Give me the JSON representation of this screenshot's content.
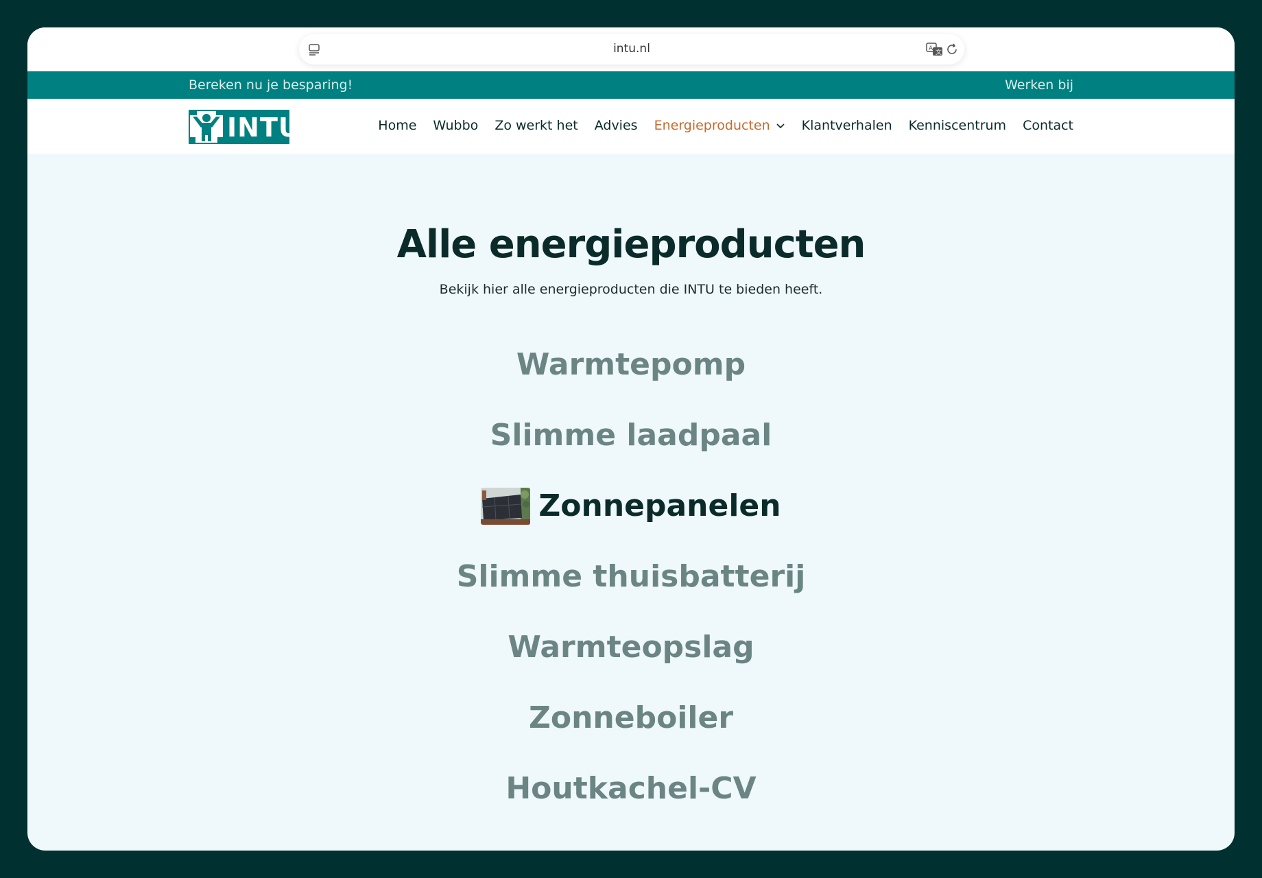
{
  "browser": {
    "url": "intu.nl"
  },
  "topbar": {
    "left_link": "Bereken nu je besparing!",
    "right_link": "Werken bij"
  },
  "logo": {
    "text": "INTU",
    "color": "#008080"
  },
  "nav": {
    "items": [
      {
        "label": "Home"
      },
      {
        "label": "Wubbo"
      },
      {
        "label": "Zo werkt het"
      },
      {
        "label": "Advies"
      },
      {
        "label": "Energieproducten",
        "active": true
      },
      {
        "label": "Klantverhalen"
      },
      {
        "label": "Kenniscentrum"
      },
      {
        "label": "Contact"
      }
    ]
  },
  "main": {
    "title": "Alle energieproducten",
    "subtitle": "Bekijk hier alle energieproducten die INTU te bieden heeft.",
    "products": [
      {
        "label": "Warmtepomp"
      },
      {
        "label": "Slimme laadpaal"
      },
      {
        "label": "Zonnepanelen",
        "active": true,
        "thumbnail": "solar-panel-image"
      },
      {
        "label": "Slimme thuisbatterij"
      },
      {
        "label": "Warmteopslag"
      },
      {
        "label": "Zonneboiler"
      },
      {
        "label": "Houtkachel-CV"
      }
    ]
  },
  "colors": {
    "teal": "#008080",
    "dark": "#0b2b2b",
    "accent": "#c56a2c",
    "muted": "#6b8585",
    "background": "#eff8fa"
  }
}
